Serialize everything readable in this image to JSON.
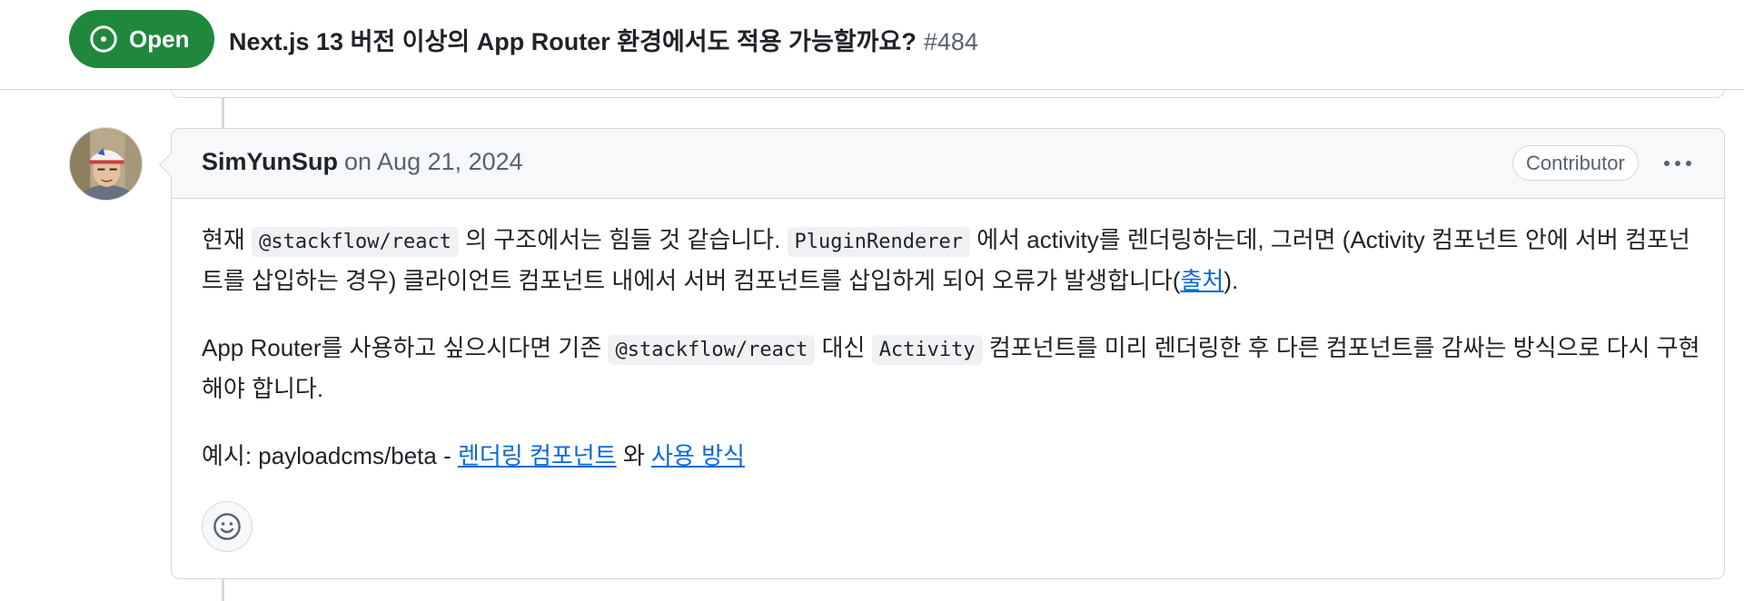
{
  "header": {
    "state_label": "Open",
    "title": "Next.js 13 버전 이상의 App Router 환경에서도 적용 가능할까요?",
    "number": "#484"
  },
  "comment": {
    "author": "SimYunSup",
    "timestamp": "on Aug 21, 2024",
    "role": "Contributor",
    "paragraphs": {
      "p1": {
        "t1": "현재 ",
        "code1": "@stackflow/react",
        "t2": " 의 구조에서는 힘들 것 같습니다. ",
        "code2": "PluginRenderer",
        "t3": " 에서 activity를 렌더링하는데, 그러면 (Activity 컴포넌트 안에 서버 컴포넌트를 삽입하는 경우) 클라이언트 컴포넌트 내에서 서버 컴포넌트를 삽입하게 되어 오류가 발생합니다(",
        "link": "출처",
        "t4": ")."
      },
      "p2": {
        "t1": "App Router를 사용하고 싶으시다면 기존 ",
        "code1": "@stackflow/react",
        "t2": " 대신 ",
        "code2": "Activity",
        "t3": " 컴포넌트를 미리 렌더링한 후 다른 컴포넌트를 감싸는 방식으로 다시 구현해야 합니다."
      },
      "p3": {
        "t1": "예시: payloadcms/beta - ",
        "link1": "렌더링 컴포넌트",
        "t2": " 와 ",
        "link2": "사용 방식"
      }
    }
  },
  "colors": {
    "open_green": "#1f883d",
    "link_blue": "#0969da",
    "border": "#d1d9e0",
    "header_bg": "#f6f8fa",
    "muted_text": "#59636e"
  },
  "icons": {
    "state": "issue-opened-icon",
    "more": "kebab-horizontal-icon",
    "reaction": "smiley-icon"
  }
}
